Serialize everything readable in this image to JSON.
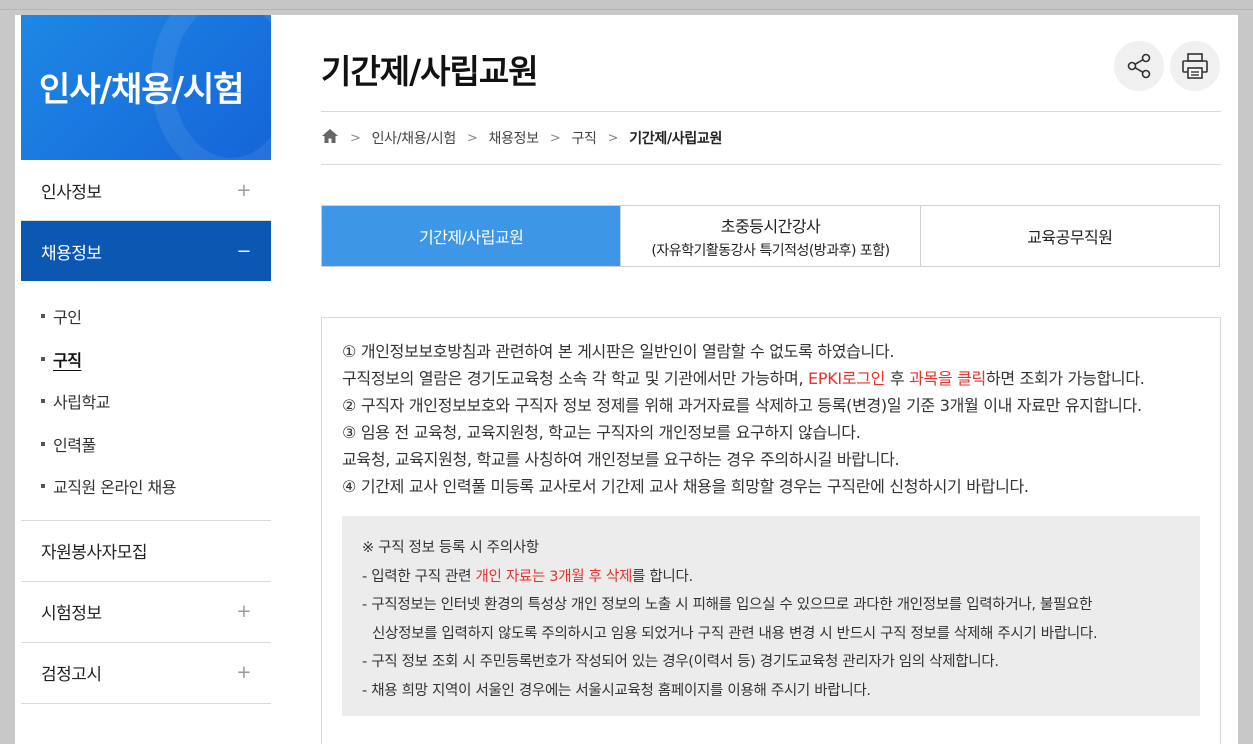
{
  "sidebar": {
    "title": "인사/채용/시험",
    "menu": [
      {
        "label": "인사정보",
        "toggle": "+"
      },
      {
        "label": "채용정보",
        "toggle": "−"
      }
    ],
    "submenu": [
      "구인",
      "구직",
      "사립학교",
      "인력풀",
      "교직원 온라인 채용"
    ],
    "menu_bottom": [
      {
        "label": "자원봉사자모집",
        "toggle": ""
      },
      {
        "label": "시험정보",
        "toggle": "+"
      },
      {
        "label": "검정고시",
        "toggle": "+"
      }
    ]
  },
  "page": {
    "title": "기간제/사립교원"
  },
  "breadcrumb": {
    "items": [
      "인사/채용/시험",
      "채용정보",
      "구직",
      "기간제/사립교원"
    ]
  },
  "tabs": [
    {
      "label": "기간제/사립교원",
      "sub": ""
    },
    {
      "label": "초중등시간강사",
      "sub": "(자유학기활동강사 특기적성(방과후) 포함)"
    },
    {
      "label": "교육공무직원",
      "sub": ""
    }
  ],
  "notice": {
    "l1": "① 개인정보보호방침과 관련하여 본 게시판은 일반인이 열람할 수 없도록 하였습니다.",
    "l2a": "구직정보의 열람은 경기도교육청 소속 각 학교 및 기관에서만 가능하며, ",
    "l2b": "EPKI로그인",
    "l2c": " 후 ",
    "l2d": "과목을 클릭",
    "l2e": "하면 조회가 가능합니다.",
    "l3": "② 구직자 개인정보보호와 구직자 정보 정제를 위해 과거자료를 삭제하고 등록(변경)일 기준 3개월 이내 자료만 유지합니다.",
    "l4": "③ 임용 전 교육청, 교육지원청, 학교는 구직자의 개인정보를 요구하지 않습니다.",
    "l5": "교육청, 교육지원청, 학교를 사칭하여 개인정보를 요구하는 경우 주의하시길 바랍니다.",
    "l6": "④ 기간제 교사 인력풀 미등록 교사로서 기간제 교사 채용을 희망할 경우는 구직란에 신청하시기 바랍니다."
  },
  "caution": {
    "head": "※ 구직 정보 등록 시 주의사항",
    "c1a": "- 입력한 구직 관련 ",
    "c1b": "개인 자료는 3개월 후 삭제",
    "c1c": "를 합니다.",
    "c2": "- 구직정보는 인터넷 환경의 특성상 개인 정보의 노출 시 피해를 입으실 수 있으므로 과다한 개인정보를 입력하거나, 불필요한",
    "c2b": "신상정보를 입력하지 않도록 주의하시고 임용 되었거나 구직 관련 내용 변경 시 반드시 구직 정보를 삭제해 주시기 바랍니다.",
    "c3": "- 구직 정보 조회 시 주민등록번호가 작성되어 있는 경우(이력서 등) 경기도교육청 관리자가 임의 삭제합니다.",
    "c4": "- 채용 희망 지역이 서울인 경우에는 서울시교육청 홈페이지를 이용해 주시기 바랍니다."
  },
  "colors": {
    "sidebar_head": "#1e88e5",
    "active_menu": "#0b57b2",
    "active_tab": "#3d97e6",
    "highlight": "#e5322d"
  },
  "icons": {
    "share": "share-icon",
    "print": "print-icon",
    "home": "home-icon"
  }
}
